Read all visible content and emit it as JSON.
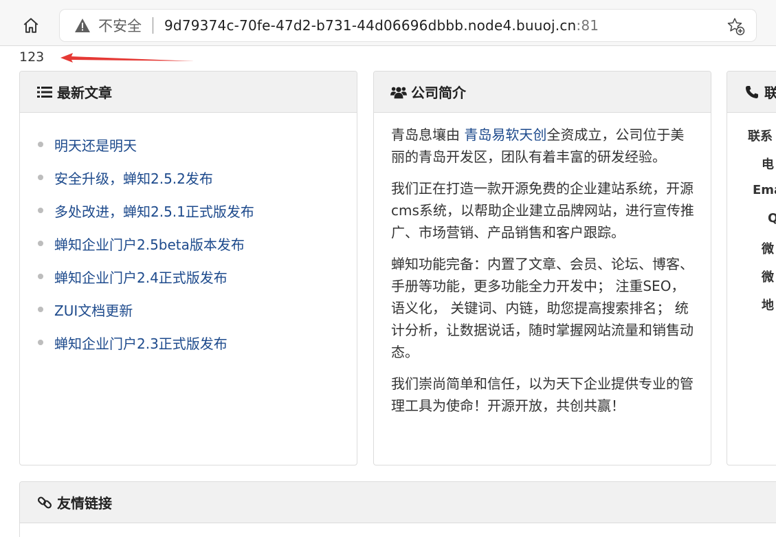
{
  "browser": {
    "security_label": "不安全",
    "url_host": "9d79374c-70fe-47d2-b731-44d06696dbbb.node4.buuoj.cn",
    "url_port": ":81",
    "icons": [
      "home-icon",
      "warning-icon",
      "favorite-add-icon"
    ]
  },
  "output_text": "123",
  "colors": {
    "link": "#1d4a8c",
    "arrow": "#e53935",
    "panel_head_bg": "#f1f1f1"
  },
  "latest_articles": {
    "title": "最新文章",
    "icon": "list-icon",
    "items": [
      "明天还是明天",
      "安全升级，蝉知2.5.2发布",
      "多处改进，蝉知2.5.1正式版发布",
      "蝉知企业门户2.5beta版本发布",
      "蝉知企业门户2.4正式版发布",
      "ZUI文档更新",
      "蝉知企业门户2.3正式版发布"
    ]
  },
  "company": {
    "title": "公司简介",
    "icon": "users-icon",
    "p1_before": "青岛息壤由 ",
    "p1_link": "青岛易软天创",
    "p1_after": "全资成立，公司位于美丽的青岛开发区，团队有着丰富的研发经验。",
    "p2": "我们正在打造一款开源免费的企业建站系统，开源cms系统，以帮助企业建立品牌网站，进行宣传推广、市场营销、产品销售和客户跟踪。",
    "p3": "蝉知功能完备：内置了文章、会员、论坛、博客、手册等功能，更多功能全力开发中； 注重SEO，语义化， 关键词、内链，助您提高搜索排名； 统计分析，让数据说话，随时掌握网站流量和销售动态。",
    "p4": "我们崇尚简单和信任，以为天下企业提供专业的管理工具为使命！开源开放，共创共赢！"
  },
  "contact": {
    "title": "联",
    "icon": "phone-icon",
    "rows": [
      "联系",
      "电",
      "Ema",
      "Q",
      "微",
      "微",
      "地"
    ]
  },
  "links": {
    "title": "友情链接",
    "icon": "link-icon"
  }
}
